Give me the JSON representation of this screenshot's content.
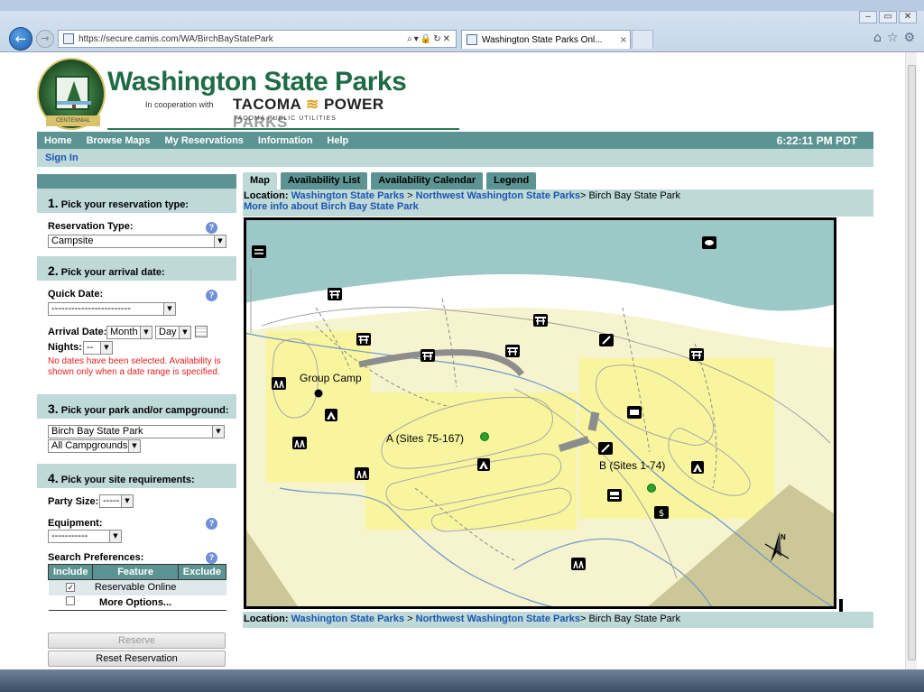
{
  "browser": {
    "url": "https://secure.camis.com/WA/BirchBayStatePark",
    "tab_title": "Washington State Parks Onl...",
    "tab_close": "×",
    "window_controls": [
      "‒",
      "▭",
      "✕"
    ],
    "address_tools": "⌕▾🔒↻✕",
    "right_icons": [
      "⌂",
      "☆",
      "⚙"
    ]
  },
  "header": {
    "title": "Washington State Parks",
    "coop_text": "In cooperation with",
    "tacoma": "TACOMA",
    "power": "POWER",
    "parks": "PARKS",
    "tpu": "TACOMA PUBLIC UTILITIES",
    "badge_top": "WASHINGTON",
    "badge_ribbon": "CENTENNIAL"
  },
  "nav": {
    "items": [
      "Home",
      "Browse Maps",
      "My Reservations",
      "Information",
      "Help"
    ],
    "clock": "6:22:11 PM PDT",
    "sign_in": "Sign In"
  },
  "steps": {
    "s1": {
      "num": "1.",
      "title": "Pick your reservation type:",
      "label": "Reservation Type:",
      "value": "Campsite"
    },
    "s2": {
      "num": "2.",
      "title": "Pick your arrival date:",
      "quick_date_label": "Quick Date:",
      "quick_date_value": "------------------------",
      "arrival_label": "Arrival Date:",
      "month": "Month",
      "day": "Day",
      "nights_label": "Nights:",
      "nights_value": "--",
      "message": "No dates have been selected. Availability is shown only when a date range is specified."
    },
    "s3": {
      "num": "3.",
      "title": "Pick your park and/or campground:",
      "park": "Birch Bay State Park",
      "campground": "All Campgrounds"
    },
    "s4": {
      "num": "4.",
      "title": "Pick your site requirements:",
      "party_label": "Party Size:",
      "party_value": "-----",
      "equipment_label": "Equipment:",
      "equipment_value": "-----------",
      "search_label": "Search Preferences:",
      "col_include": "Include",
      "col_feature": "Feature",
      "col_exclude": "Exclude",
      "row_feature": "Reservable Online",
      "row_check": "✓",
      "more_options": "More Options..."
    },
    "help_glyph": "?",
    "arrow_glyph": "▼"
  },
  "buttons": {
    "reserve": "Reserve",
    "reset": "Reset Reservation"
  },
  "map_tabs": [
    "Map",
    "Availability List",
    "Availability Calendar",
    "Legend"
  ],
  "location": {
    "label": "Location:",
    "crumb1": "Washington State Parks",
    "sep1": ">",
    "crumb2": "Northwest Washington State Parks",
    "current": "> Birch Bay State Park",
    "more_info": "More info about Birch Bay State Park"
  },
  "map": {
    "labels": {
      "group_camp": "Group Camp",
      "loop_a": "A (Sites 75-167)",
      "loop_b": "B (Sites 1-74)",
      "north": "N"
    },
    "colors": {
      "water": "#9cc8c8",
      "sand": "#f6f3cf",
      "loop": "#f9f59f",
      "hill": "#cbc797",
      "road": "#8d8d8d",
      "creek": "#6e97c8"
    }
  }
}
